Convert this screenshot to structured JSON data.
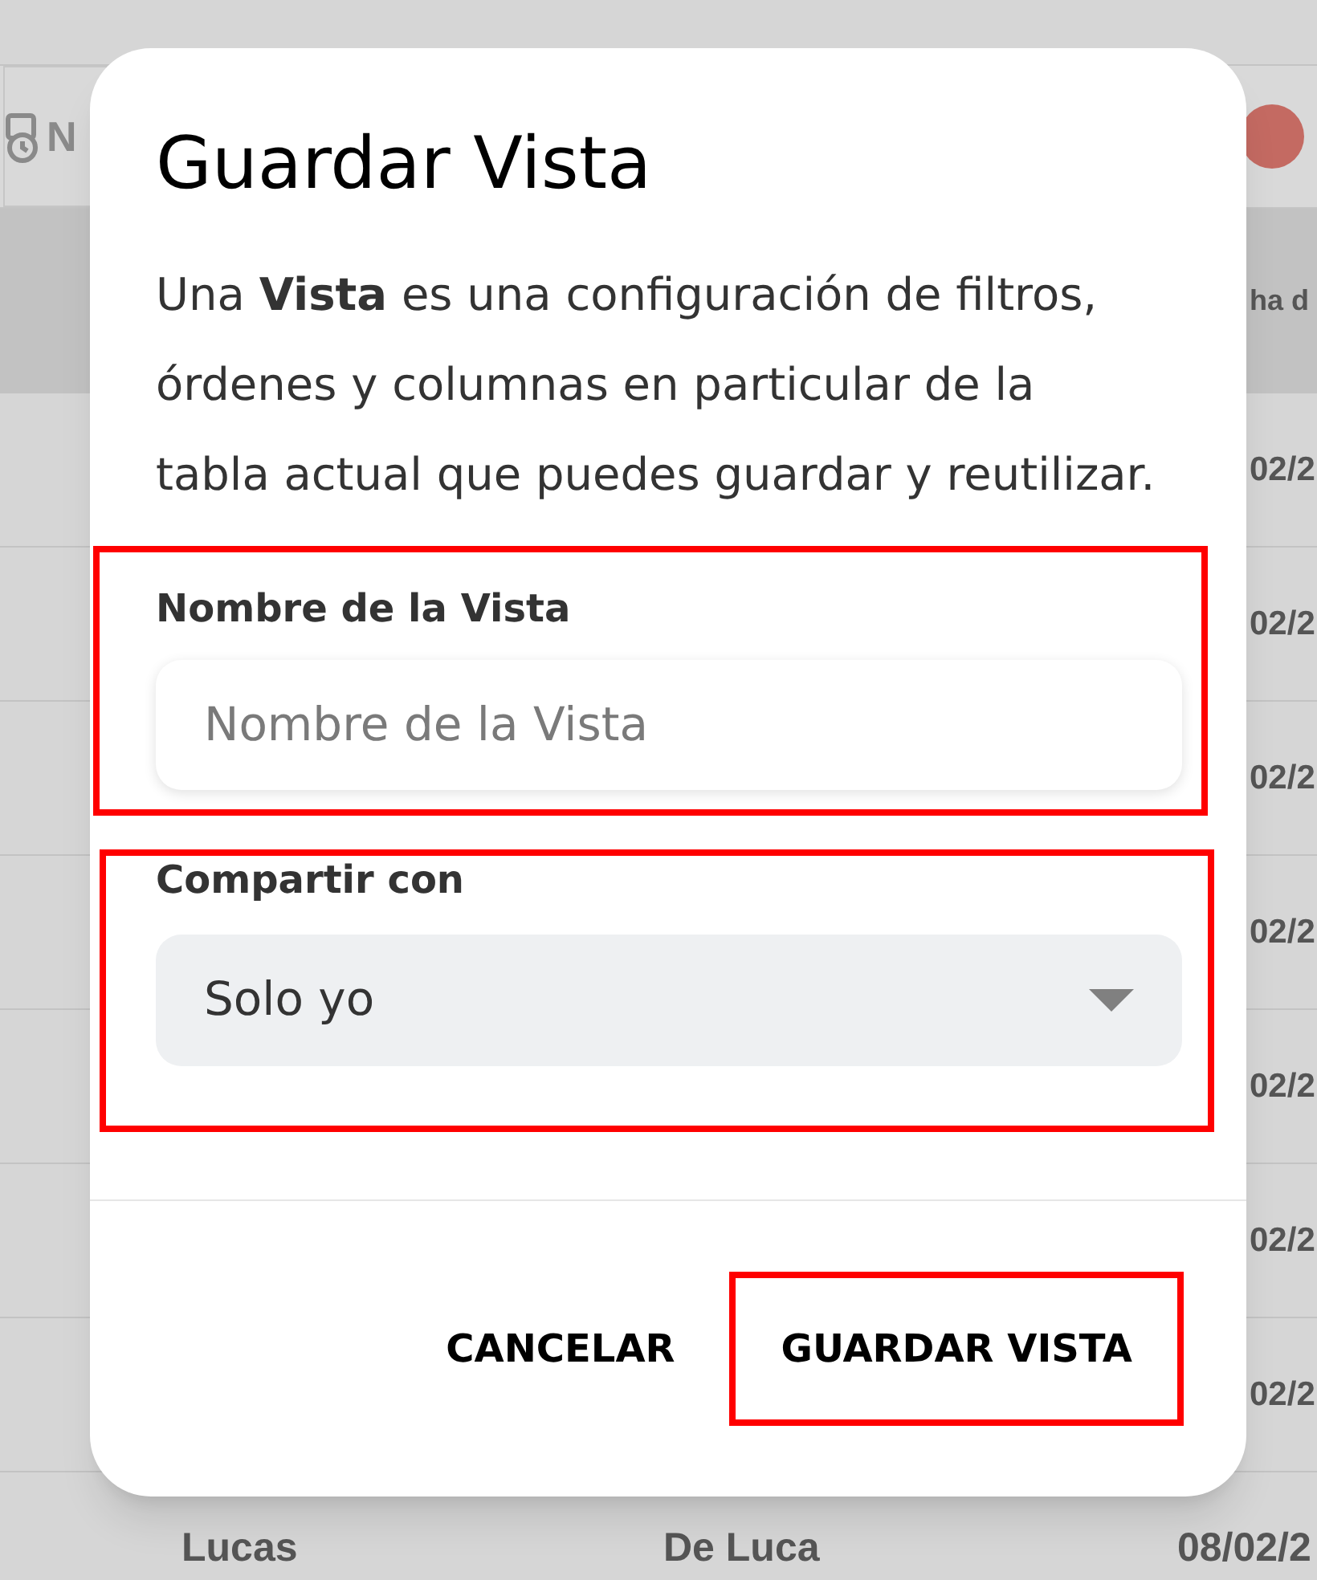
{
  "background": {
    "toolbar_label": "N",
    "column_header": "ha d",
    "row_dates": [
      "02/2",
      "02/2",
      "02/2",
      "02/2",
      "02/2",
      "02/2",
      "02/2"
    ],
    "last_row": {
      "first_name": "Lucas",
      "last_name": "De Luca",
      "date": "08/02/2"
    }
  },
  "dialog": {
    "title": "Guardar Vista",
    "description": "Una **Vista** es una configuración de filtros, órdenes y columnas en particular de la tabla actual que puedes guardar y reutilizar.",
    "name_field": {
      "label": "Nombre de la Vista",
      "placeholder": "Nombre de la Vista"
    },
    "share_field": {
      "label": "Compartir con",
      "value": "Solo yo"
    },
    "buttons": [
      {
        "label": "CANCELAR",
        "highlighted": false
      },
      {
        "label": "GUARDAR VISTA",
        "highlighted": true
      }
    ]
  }
}
